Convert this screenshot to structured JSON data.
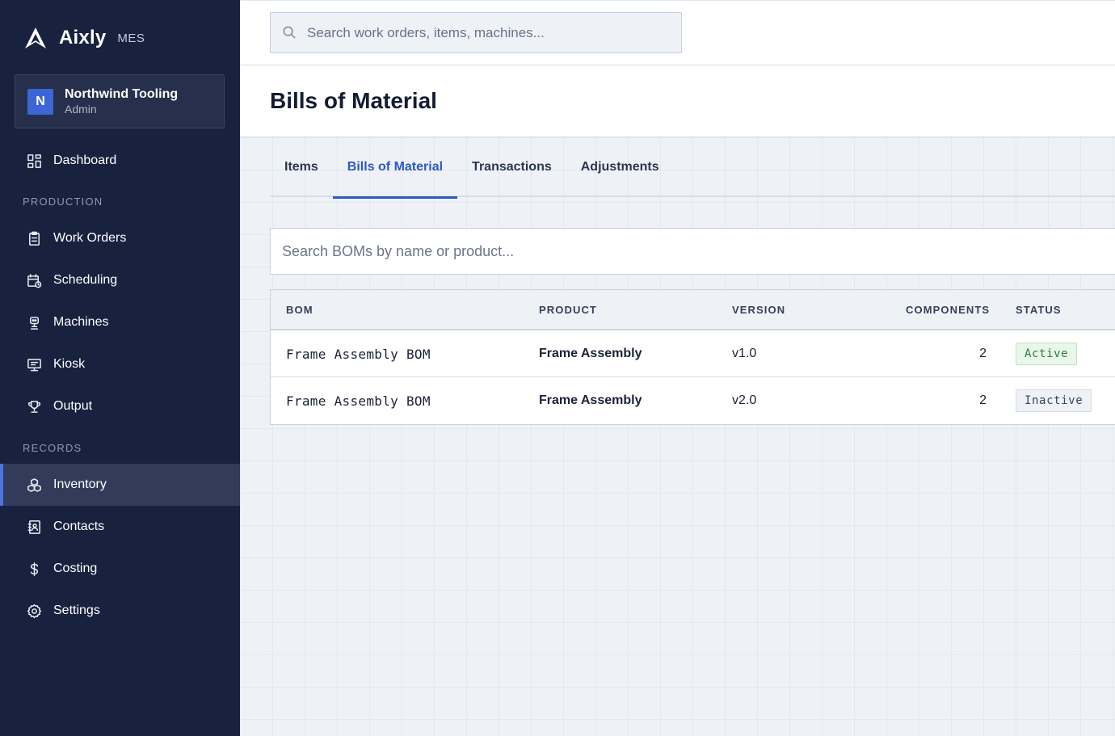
{
  "brand": {
    "name": "Aixly",
    "suffix": "MES"
  },
  "org": {
    "initial": "N",
    "name": "Northwind Tooling",
    "role": "Admin"
  },
  "nav": {
    "dashboard": "Dashboard",
    "production_section": "PRODUCTION",
    "production": [
      "Work Orders",
      "Scheduling",
      "Machines",
      "Kiosk",
      "Output"
    ],
    "records_section": "RECORDS",
    "records": [
      "Inventory",
      "Contacts",
      "Costing",
      "Settings"
    ],
    "active": "Inventory"
  },
  "search": {
    "placeholder": "Search work orders, items, machines..."
  },
  "page": {
    "title": "Bills of Material"
  },
  "tabs": [
    {
      "label": "Items",
      "active": false
    },
    {
      "label": "Bills of Material",
      "active": true
    },
    {
      "label": "Transactions",
      "active": false
    },
    {
      "label": "Adjustments",
      "active": false
    }
  ],
  "bom_search": {
    "placeholder": "Search BOMs by name or product..."
  },
  "table": {
    "headers": [
      "BOM",
      "PRODUCT",
      "VERSION",
      "COMPONENTS",
      "STATUS"
    ],
    "rows": [
      {
        "bom": "Frame Assembly BOM",
        "product": "Frame Assembly",
        "version": "v1.0",
        "components": "2",
        "status": "Active"
      },
      {
        "bom": "Frame Assembly BOM",
        "product": "Frame Assembly",
        "version": "v2.0",
        "components": "2",
        "status": "Inactive"
      }
    ]
  },
  "colors": {
    "sidebar": "#18223f",
    "accent": "#2c59c4",
    "active_badge": "#2e7d38"
  }
}
